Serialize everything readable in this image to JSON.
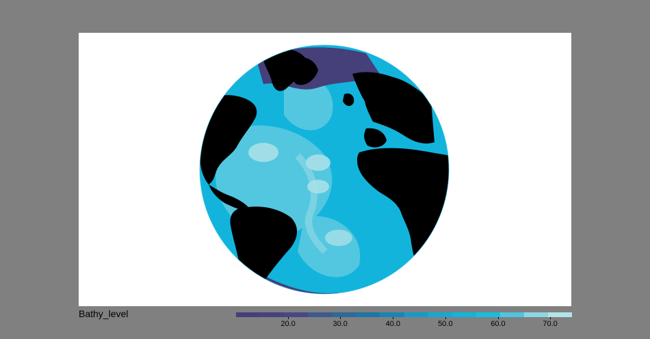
{
  "colorbar": {
    "variable_label": "Bathy_level",
    "colors": [
      "#453f7a",
      "#47427e",
      "#494884",
      "#3f5b8d",
      "#2d6a99",
      "#1e76a7",
      "#1a84b4",
      "#199ac6",
      "#16a8d2",
      "#12b4dc",
      "#18bcdd",
      "#4fc5df",
      "#8dd7e4",
      "#b4e4ea"
    ],
    "tick_labels": [
      "20.0",
      "30.0",
      "40.0",
      "50.0",
      "60.0",
      "70.0"
    ],
    "tick_positions_fraction": [
      0.155,
      0.31,
      0.467,
      0.623,
      0.78,
      0.935
    ]
  },
  "map": {
    "projection": "orthographic",
    "land_color": "#000000",
    "deep_ocean_color": "#12b4dc",
    "shelf_color": "#3f5b8d",
    "ridge_color": "#8dd7e4"
  }
}
